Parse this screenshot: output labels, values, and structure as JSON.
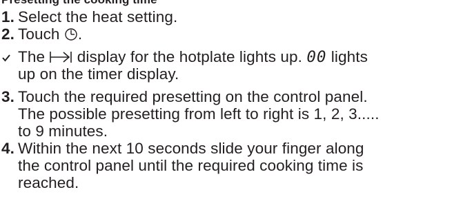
{
  "header_partial": "Presetting the cooking time",
  "steps": [
    {
      "num": "1.",
      "lines": [
        "Select the heat setting."
      ]
    },
    {
      "num": "2.",
      "before_icon": "Touch ",
      "icon": "timer-clock-icon",
      "after_icon": "."
    },
    {
      "result": true,
      "line1_a": "The ",
      "icon": "presetting-arrow-icon",
      "line1_b": " display for the hotplate lights up. ",
      "seg_value": "00",
      "line1_c": " lights",
      "line2": "up on the timer display."
    },
    {
      "num": "3.",
      "lines": [
        "Touch the required presetting on the control panel.",
        "The possible presetting from left to right is 1, 2, 3.....",
        "to 9 minutes."
      ]
    },
    {
      "num": "4.",
      "lines": [
        "Within the next 10 seconds slide your finger along",
        "the control panel until the required cooking time is",
        "reached."
      ]
    }
  ]
}
